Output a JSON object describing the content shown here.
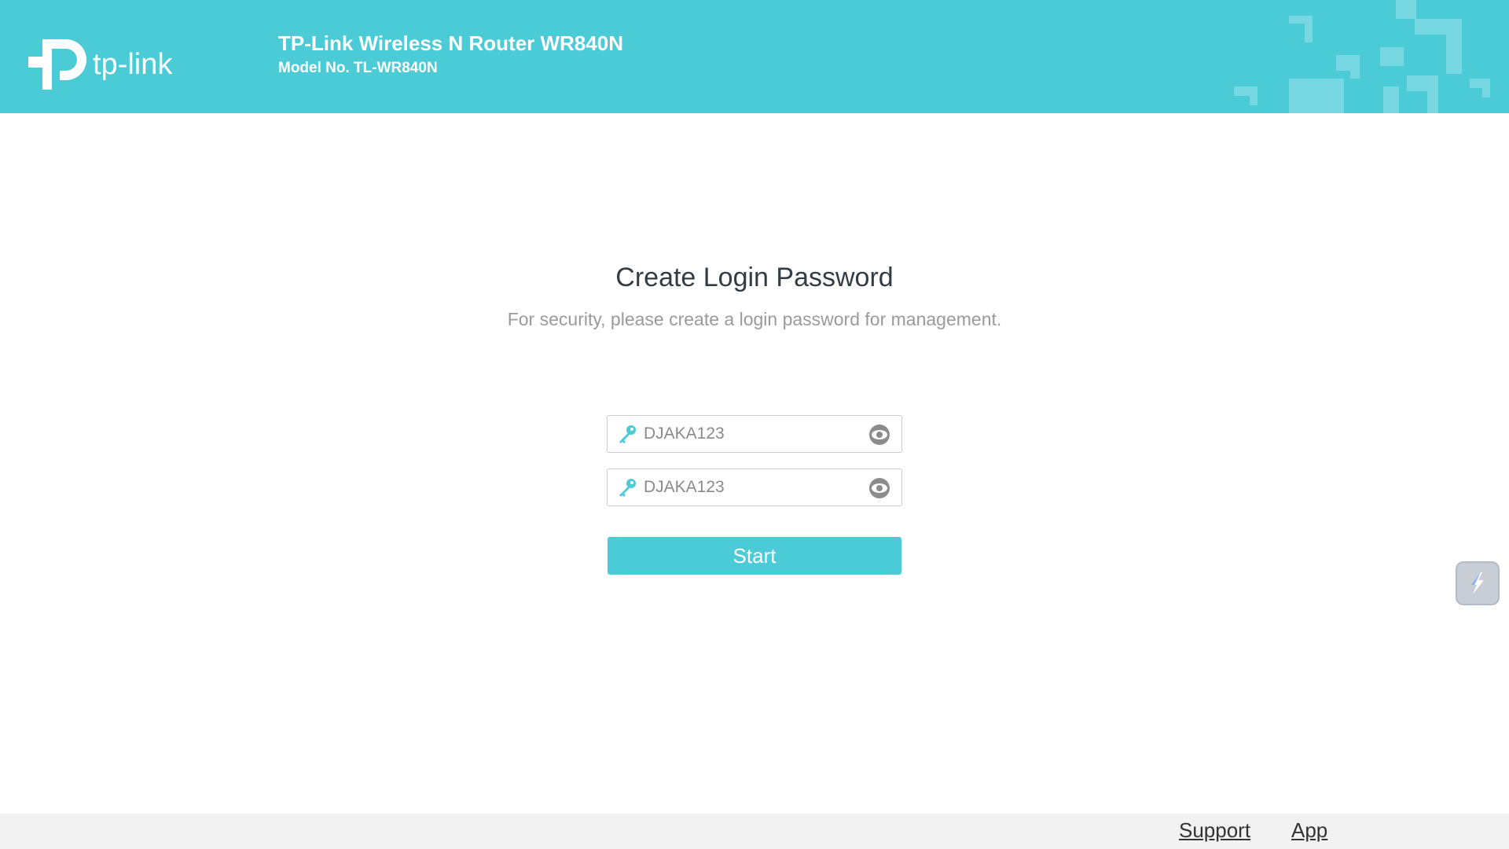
{
  "header": {
    "logo_text": "tp-link",
    "product_name": "TP-Link Wireless N Router WR840N",
    "model_no": "Model No. TL-WR840N"
  },
  "main": {
    "title": "Create Login Password",
    "subtitle": "For security, please create a login password for management.",
    "password_field": {
      "value": "DJAKA123",
      "icon": "key-icon",
      "toggle_icon": "eye-icon"
    },
    "confirm_password_field": {
      "value": "DJAKA123",
      "icon": "key-icon",
      "toggle_icon": "eye-icon"
    },
    "start_button_label": "Start"
  },
  "side_widget": {
    "icon": "lightning-icon"
  },
  "footer": {
    "support_label": "Support",
    "app_label": "App"
  },
  "colors": {
    "brand": "#4acbd6",
    "title_text": "#333c44",
    "subtitle_text": "#9a9a9a",
    "footer_bg": "#f2f2f2"
  }
}
